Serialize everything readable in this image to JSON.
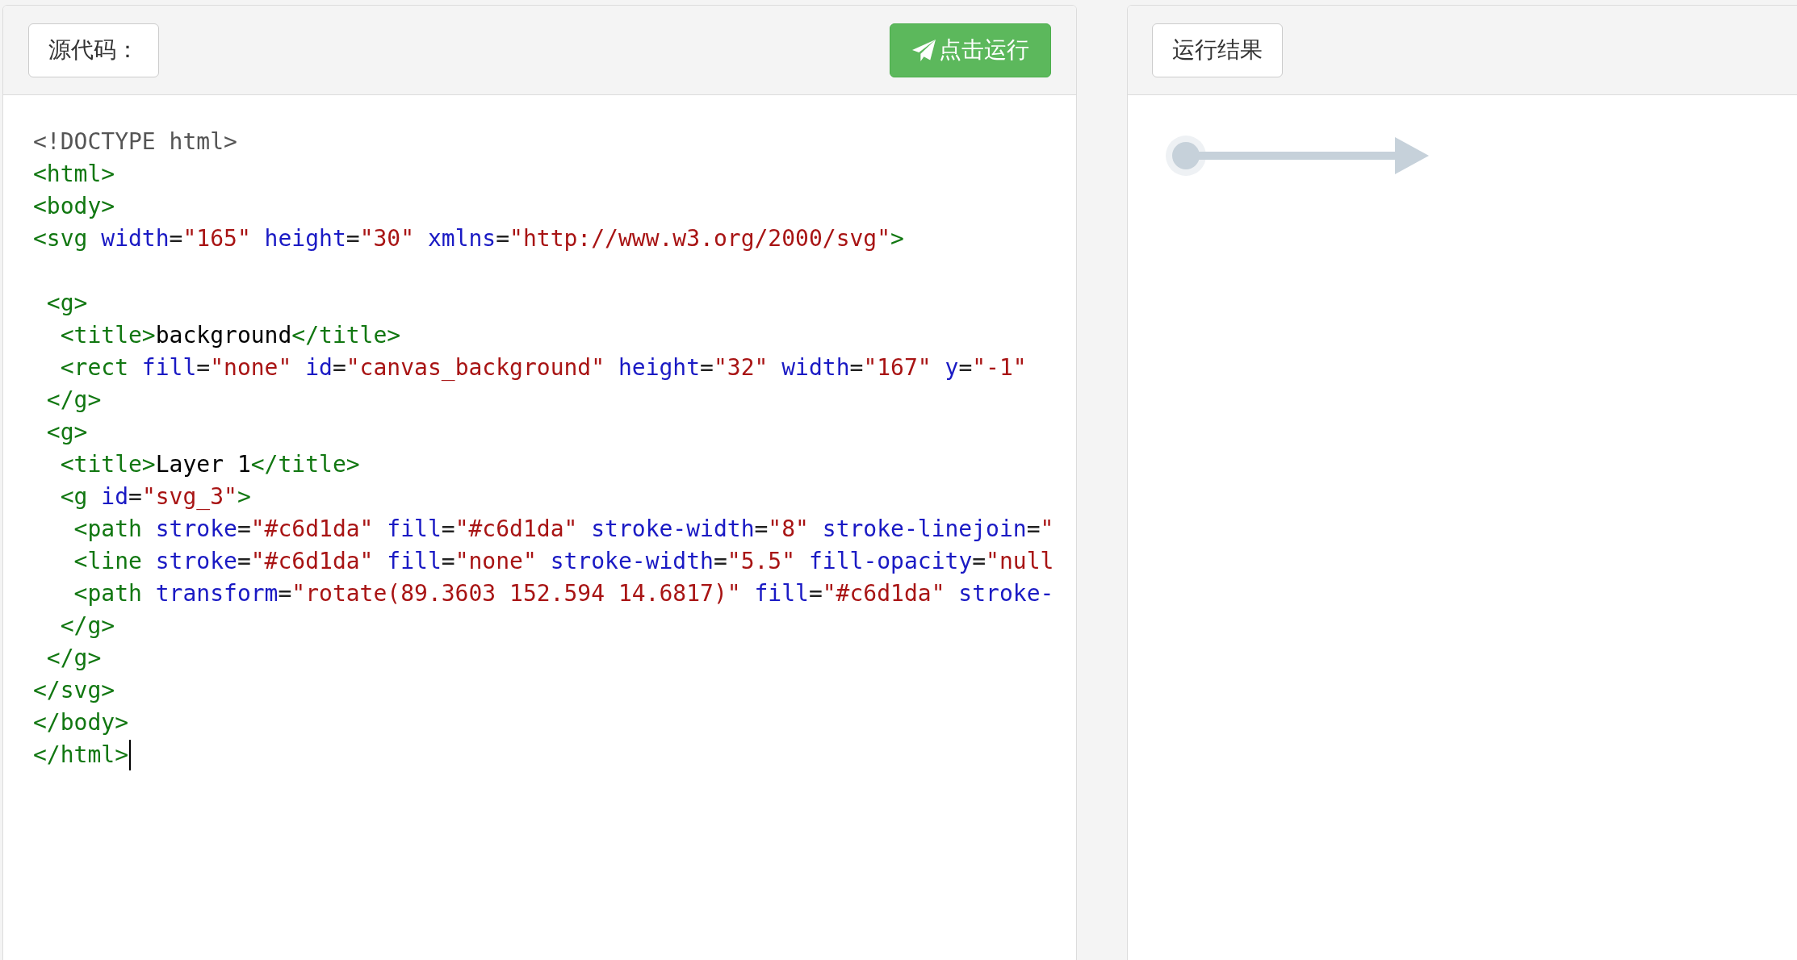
{
  "editor_panel": {
    "label_button": "源代码：",
    "run_button": "点击运行",
    "cursor_at_end": true,
    "code_lines": [
      {
        "kind": "code",
        "tokens": [
          {
            "kind": "doctype",
            "text": "<!DOCTYPE html>"
          }
        ]
      },
      {
        "kind": "code",
        "tokens": [
          {
            "kind": "tag",
            "text": "<html>"
          }
        ]
      },
      {
        "kind": "code",
        "tokens": [
          {
            "kind": "tag",
            "text": "<body>"
          }
        ]
      },
      {
        "kind": "code",
        "tokens": [
          {
            "kind": "tag",
            "text": "<svg"
          },
          {
            "kind": "attr",
            "text": " width"
          },
          {
            "kind": "punct",
            "text": "="
          },
          {
            "kind": "value",
            "text": "\"165\""
          },
          {
            "kind": "attr",
            "text": " height"
          },
          {
            "kind": "punct",
            "text": "="
          },
          {
            "kind": "value",
            "text": "\"30\""
          },
          {
            "kind": "attr",
            "text": " xmlns"
          },
          {
            "kind": "punct",
            "text": "="
          },
          {
            "kind": "value",
            "text": "\"http://www.w3.org/2000/svg\""
          },
          {
            "kind": "tag",
            "text": ">"
          }
        ]
      },
      {
        "kind": "blank"
      },
      {
        "kind": "code",
        "tokens": [
          {
            "kind": "tag",
            "text": " <g>"
          }
        ]
      },
      {
        "kind": "code",
        "tokens": [
          {
            "kind": "tag",
            "text": "  <title>"
          },
          {
            "kind": "text",
            "text": "background"
          },
          {
            "kind": "tag",
            "text": "</title>"
          }
        ]
      },
      {
        "kind": "code",
        "tokens": [
          {
            "kind": "tag",
            "text": "  <rect"
          },
          {
            "kind": "attr",
            "text": " fill"
          },
          {
            "kind": "punct",
            "text": "="
          },
          {
            "kind": "value",
            "text": "\"none\""
          },
          {
            "kind": "attr",
            "text": " id"
          },
          {
            "kind": "punct",
            "text": "="
          },
          {
            "kind": "value",
            "text": "\"canvas_background\""
          },
          {
            "kind": "attr",
            "text": " height"
          },
          {
            "kind": "punct",
            "text": "="
          },
          {
            "kind": "value",
            "text": "\"32\""
          },
          {
            "kind": "attr",
            "text": " width"
          },
          {
            "kind": "punct",
            "text": "="
          },
          {
            "kind": "value",
            "text": "\"167\""
          },
          {
            "kind": "attr",
            "text": " y"
          },
          {
            "kind": "punct",
            "text": "="
          },
          {
            "kind": "value",
            "text": "\"-1\""
          }
        ]
      },
      {
        "kind": "code",
        "tokens": [
          {
            "kind": "tag",
            "text": " </g>"
          }
        ]
      },
      {
        "kind": "code",
        "tokens": [
          {
            "kind": "tag",
            "text": " <g>"
          }
        ]
      },
      {
        "kind": "code",
        "tokens": [
          {
            "kind": "tag",
            "text": "  <title>"
          },
          {
            "kind": "text",
            "text": "Layer 1"
          },
          {
            "kind": "tag",
            "text": "</title>"
          }
        ]
      },
      {
        "kind": "code",
        "tokens": [
          {
            "kind": "tag",
            "text": "  <g"
          },
          {
            "kind": "attr",
            "text": " id"
          },
          {
            "kind": "punct",
            "text": "="
          },
          {
            "kind": "value",
            "text": "\"svg_3\""
          },
          {
            "kind": "tag",
            "text": ">"
          }
        ]
      },
      {
        "kind": "code",
        "tokens": [
          {
            "kind": "tag",
            "text": "   <path"
          },
          {
            "kind": "attr",
            "text": " stroke"
          },
          {
            "kind": "punct",
            "text": "="
          },
          {
            "kind": "value",
            "text": "\"#c6d1da\""
          },
          {
            "kind": "attr",
            "text": " fill"
          },
          {
            "kind": "punct",
            "text": "="
          },
          {
            "kind": "value",
            "text": "\"#c6d1da\""
          },
          {
            "kind": "attr",
            "text": " stroke-width"
          },
          {
            "kind": "punct",
            "text": "="
          },
          {
            "kind": "value",
            "text": "\"8\""
          },
          {
            "kind": "attr",
            "text": " stroke-linejoin"
          },
          {
            "kind": "punct",
            "text": "="
          },
          {
            "kind": "value",
            "text": "\""
          }
        ]
      },
      {
        "kind": "code",
        "tokens": [
          {
            "kind": "tag",
            "text": "   <line"
          },
          {
            "kind": "attr",
            "text": " stroke"
          },
          {
            "kind": "punct",
            "text": "="
          },
          {
            "kind": "value",
            "text": "\"#c6d1da\""
          },
          {
            "kind": "attr",
            "text": " fill"
          },
          {
            "kind": "punct",
            "text": "="
          },
          {
            "kind": "value",
            "text": "\"none\""
          },
          {
            "kind": "attr",
            "text": " stroke-width"
          },
          {
            "kind": "punct",
            "text": "="
          },
          {
            "kind": "value",
            "text": "\"5.5\""
          },
          {
            "kind": "attr",
            "text": " fill-opacity"
          },
          {
            "kind": "punct",
            "text": "="
          },
          {
            "kind": "value",
            "text": "\"null"
          }
        ]
      },
      {
        "kind": "code",
        "tokens": [
          {
            "kind": "tag",
            "text": "   <path"
          },
          {
            "kind": "attr",
            "text": " transform"
          },
          {
            "kind": "punct",
            "text": "="
          },
          {
            "kind": "value",
            "text": "\"rotate(89.3603 152.594 14.6817)\""
          },
          {
            "kind": "attr",
            "text": " fill"
          },
          {
            "kind": "punct",
            "text": "="
          },
          {
            "kind": "value",
            "text": "\"#c6d1da\""
          },
          {
            "kind": "attr",
            "text": " stroke-"
          }
        ]
      },
      {
        "kind": "code",
        "tokens": [
          {
            "kind": "tag",
            "text": "  </g>"
          }
        ]
      },
      {
        "kind": "code",
        "tokens": [
          {
            "kind": "tag",
            "text": " </g>"
          }
        ]
      },
      {
        "kind": "code",
        "tokens": [
          {
            "kind": "tag",
            "text": "</svg>"
          }
        ]
      },
      {
        "kind": "code",
        "tokens": [
          {
            "kind": "tag",
            "text": "</body>"
          }
        ]
      },
      {
        "kind": "code",
        "tokens": [
          {
            "kind": "tag",
            "text": "</html>"
          }
        ]
      }
    ]
  },
  "result_panel": {
    "label_button": "运行结果"
  }
}
